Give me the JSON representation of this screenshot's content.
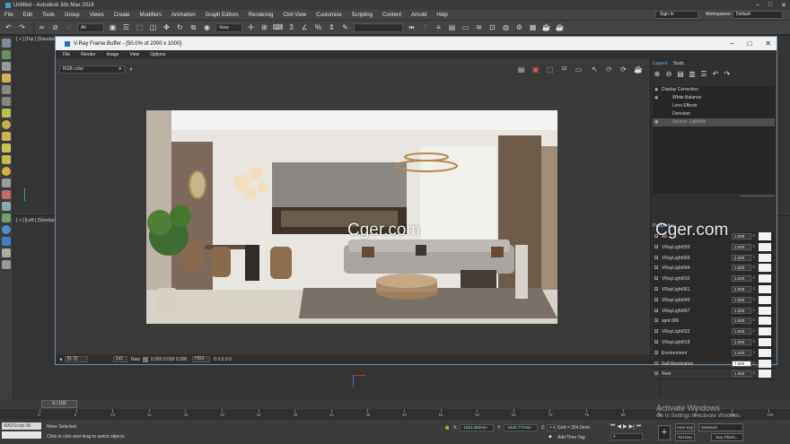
{
  "app": {
    "title": "Untitled - Autodesk 3ds Max 2018",
    "menu": [
      "File",
      "Edit",
      "Tools",
      "Group",
      "Views",
      "Create",
      "Modifiers",
      "Animation",
      "Graph Editors",
      "Rendering",
      "Civil View",
      "Customize",
      "Scripting",
      "Content",
      "Arnold",
      "Help"
    ],
    "sign_in": "Sign In",
    "workspaces_label": "Workspaces:",
    "workspace_value": "Default",
    "selection_filter": "All",
    "ref_coord": "View"
  },
  "viewports": {
    "top_label": "[ + ] [Top ] [Standard ] [",
    "left_label": "[ + ] [Left ] [Standard ] ["
  },
  "frame_buffer": {
    "title": "V-Ray Frame Buffer - [50.0% of 2000 x 1000]",
    "menu": [
      "File",
      "Render",
      "Image",
      "View",
      "Options"
    ],
    "channel": "RGB color",
    "status": {
      "coords": "[0, 0]",
      "ratio": "1x1",
      "raw_label": "Raw",
      "raw_values": "0.000  0.000  0.000",
      "mode": "HSV",
      "hsv_values": "0    0.0   0.0"
    }
  },
  "layers_panel": {
    "tabs": [
      "Layers",
      "Stats"
    ],
    "tree": [
      {
        "label": "Display Correction",
        "eye": true,
        "selected": false
      },
      {
        "label": "White Balance",
        "eye": true,
        "selected": false
      },
      {
        "label": "Lens Effects",
        "eye": false,
        "selected": false
      },
      {
        "label": "Denoiser",
        "eye": false,
        "selected": false
      },
      {
        "label": "Source: LightMix",
        "eye": true,
        "selected": true
      }
    ],
    "properties_title": "Properties",
    "properties": [
      {
        "name": "All",
        "value": "1.000"
      },
      {
        "name": "VRayLight093",
        "value": "1.000"
      },
      {
        "name": "VRayLight069",
        "value": "1.000"
      },
      {
        "name": "VRayLight094",
        "value": "1.000"
      },
      {
        "name": "VRayLight010",
        "value": "1.000"
      },
      {
        "name": "VRayLight061",
        "value": "1.000"
      },
      {
        "name": "VRayLight040",
        "value": "1.000"
      },
      {
        "name": "VRayLight067",
        "value": "1.000"
      },
      {
        "name": "spot 006",
        "value": "1.000"
      },
      {
        "name": "VRayLight022",
        "value": "1.000"
      },
      {
        "name": "VRayLight019",
        "value": "1.000"
      },
      {
        "name": "Environment",
        "value": "1.000"
      },
      {
        "name": "Self Illumination",
        "value": "7.000"
      },
      {
        "name": "Rest",
        "value": "1.000"
      }
    ]
  },
  "watermarks": [
    "Cger.com",
    "Cger.com"
  ],
  "timeline": {
    "slider": "0 / 100",
    "ticks": [
      "0",
      "5",
      "10",
      "15",
      "20",
      "25",
      "30",
      "35",
      "40",
      "45",
      "50",
      "55",
      "60",
      "65",
      "70",
      "75",
      "80",
      "85",
      "90",
      "95",
      "100"
    ]
  },
  "statusbar": {
    "maxscript": "MAXScript Mi",
    "selection": "None Selected",
    "prompt": "Click or click-and-drag to select objects",
    "x_label": "X:",
    "x_value": "-1613.454mm",
    "y_label": "Y:",
    "y_value": "-2424.777mm",
    "z_label": "Z:",
    "z_value": "0.0mm",
    "grid": "Grid = 254.0mm",
    "add_time_tag": "Add Time Tag",
    "auto_key": "Auto Key",
    "set_key": "Set Key",
    "selected": "Selected",
    "key_filters": "Key Filters...",
    "frame": "0",
    "activate_title": "Activate Windows",
    "activate_sub": "Go to Settings to activate Windows."
  }
}
